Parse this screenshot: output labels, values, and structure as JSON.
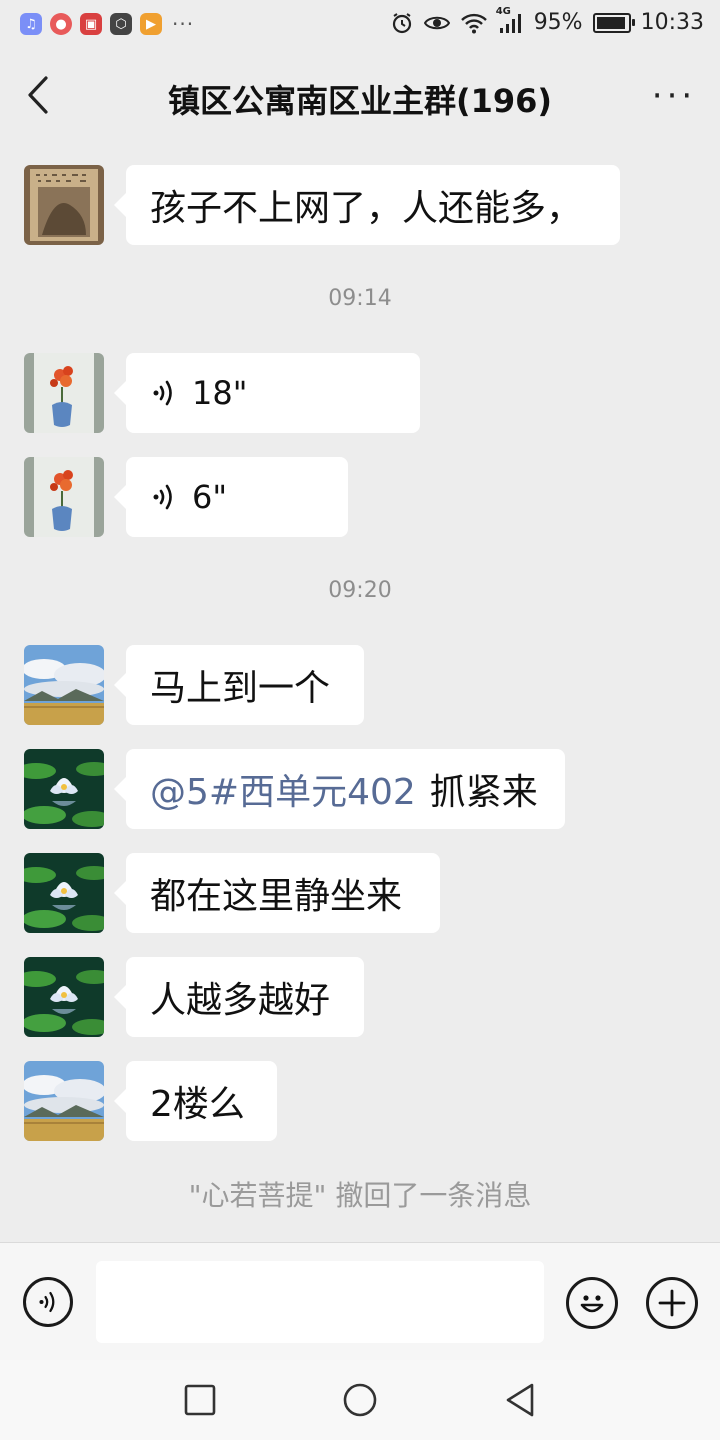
{
  "status_bar": {
    "battery": "95%",
    "battery_level": 0.95,
    "time": "10:33",
    "network": "4G",
    "overflow": "···",
    "notification_icons": [
      "music-app-icon",
      "red-app-icon-1",
      "red-app-icon-2",
      "hexagon-app-icon",
      "play-app-icon"
    ]
  },
  "header": {
    "title": "镇区公寓南区业主群(196)",
    "more": "···"
  },
  "messages": [
    {
      "type": "text",
      "text": "孩子不上网了，人还能多，",
      "avatar": "calligraphy-avatar"
    },
    {
      "type": "timestamp",
      "text": "09:14"
    },
    {
      "type": "voice",
      "duration": "18\"",
      "avatar": "flower-vase-avatar"
    },
    {
      "type": "voice",
      "duration": "6\"",
      "avatar": "flower-vase-avatar"
    },
    {
      "type": "timestamp",
      "text": "09:20"
    },
    {
      "type": "text",
      "text": "马上到一个",
      "avatar": "landscape-avatar"
    },
    {
      "type": "mention",
      "mention": "@5#西单元402",
      "text": "抓紧来",
      "avatar": "lotus-avatar"
    },
    {
      "type": "text",
      "text": "都在这里静坐来",
      "avatar": "lotus-avatar"
    },
    {
      "type": "text",
      "text": "人越多越好",
      "avatar": "lotus-avatar"
    },
    {
      "type": "text",
      "text": "2楼么",
      "avatar": "landscape-avatar"
    }
  ],
  "recall_notice": "\"心若菩提\" 撤回了一条消息",
  "input": {
    "value": "",
    "placeholder": ""
  },
  "colors": {
    "background": "#ededed",
    "bubble": "#ffffff",
    "mention": "#576b95",
    "timestamp": "#8d8d8d"
  }
}
